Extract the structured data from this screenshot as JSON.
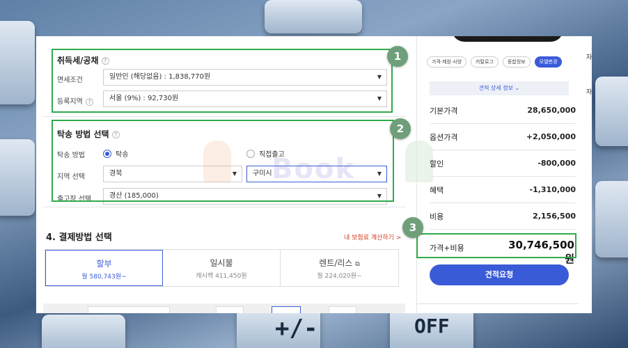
{
  "taxes": {
    "title": "취득세/공채",
    "help": "?",
    "exemption_label": "면세조건",
    "exemption_value": "일반인 (해당없음) : 1,838,770원",
    "region_label": "등록지역",
    "region_value": "서울 (9%) : 92,730원"
  },
  "delivery": {
    "title": "탁송 방법 선택",
    "help": "?",
    "method_label": "탁송 방법",
    "option_delivery": "탁송",
    "option_pickup": "직접출고",
    "region_label": "지역 선택",
    "region_value": "경북",
    "city_value": "구미시",
    "depot_label": "출고장 선택",
    "depot_value": "경산 (185,000)"
  },
  "payment": {
    "title": "4. 결제방법 선택",
    "insurance_link": "내 보험료 계산하기 >",
    "tabs": [
      {
        "label": "할부",
        "sub": "월 580,743원~"
      },
      {
        "label": "일시불",
        "sub": "캐시백 411,450원"
      },
      {
        "label": "렌트/리스",
        "sub": "월 224,020원~"
      }
    ]
  },
  "summary": {
    "chips": [
      "가격·제원·사양",
      "카탈로그",
      "종합정보",
      "모델변경"
    ],
    "detail_button": "견적 상세 정보",
    "rows": [
      {
        "label": "기본가격",
        "value": "28,650,000"
      },
      {
        "label": "옵션가격",
        "value": "+2,050,000"
      },
      {
        "label": "할인",
        "value": "-800,000"
      },
      {
        "label": "혜택",
        "value": "-1,310,000"
      },
      {
        "label": "비용",
        "value": "2,156,500"
      }
    ],
    "total_label": "가격+비용",
    "total_value": "30,746,500원",
    "quote_button": "견적요청"
  },
  "annotations": {
    "badge1": "1",
    "badge2": "2",
    "badge3": "3"
  },
  "watermark": "Book",
  "colors": {
    "accent": "#3a5bd8",
    "highlight_box": "#2faa4b",
    "badge": "#6f9f7a"
  }
}
